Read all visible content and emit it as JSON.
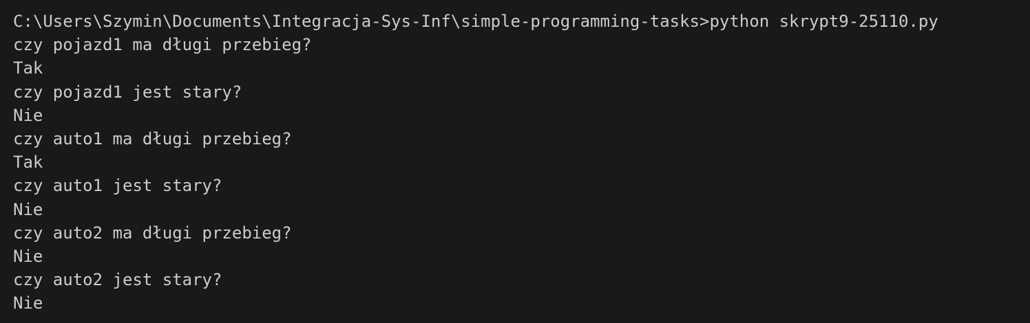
{
  "terminal": {
    "lines": [
      "C:\\Users\\Szymin\\Documents\\Integracja-Sys-Inf\\simple-programming-tasks>python skrypt9-25110.py",
      "czy pojazd1 ma długi przebieg?",
      "Tak",
      "czy pojazd1 jest stary?",
      "Nie",
      "czy auto1 ma długi przebieg?",
      "Tak",
      "czy auto1 jest stary?",
      "Nie",
      "czy auto2 ma długi przebieg?",
      "Nie",
      "czy auto2 jest stary?",
      "Nie"
    ]
  }
}
